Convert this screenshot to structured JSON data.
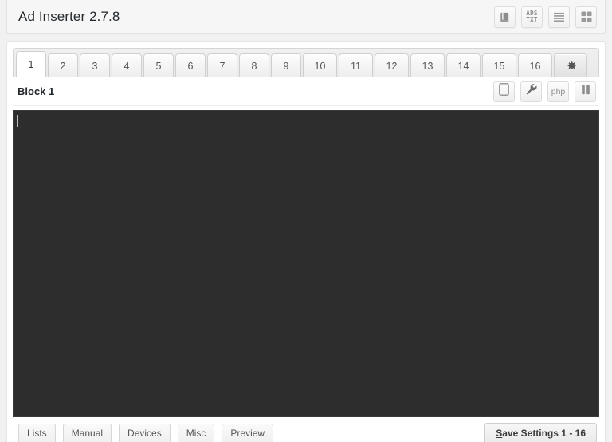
{
  "header": {
    "title": "Ad Inserter 2.7.8",
    "icons": [
      {
        "name": "book-icon",
        "label": "Documentation"
      },
      {
        "name": "ads-txt-icon",
        "label": "ADS TXT",
        "line1": "ADS",
        "line2": "TXT"
      },
      {
        "name": "list-icon",
        "label": "List view"
      },
      {
        "name": "grid-icon",
        "label": "Grid view"
      }
    ]
  },
  "tabs": {
    "items": [
      {
        "label": "1",
        "active": true
      },
      {
        "label": "2",
        "active": false
      },
      {
        "label": "3",
        "active": false
      },
      {
        "label": "4",
        "active": false
      },
      {
        "label": "5",
        "active": false
      },
      {
        "label": "6",
        "active": false
      },
      {
        "label": "7",
        "active": false
      },
      {
        "label": "8",
        "active": false
      },
      {
        "label": "9",
        "active": false
      },
      {
        "label": "10",
        "active": false
      },
      {
        "label": "11",
        "active": false
      },
      {
        "label": "12",
        "active": false
      },
      {
        "label": "13",
        "active": false
      },
      {
        "label": "14",
        "active": false
      },
      {
        "label": "15",
        "active": false
      },
      {
        "label": "16",
        "active": false
      }
    ],
    "settings_tab": {
      "name": "gear-icon",
      "label": ""
    }
  },
  "block": {
    "name": "Block 1",
    "tools": [
      {
        "name": "device-icon",
        "label": ""
      },
      {
        "name": "wrench-icon",
        "label": ""
      },
      {
        "name": "php-button",
        "label": "php"
      },
      {
        "name": "pause-icon",
        "label": ""
      }
    ]
  },
  "editor": {
    "value": "",
    "placeholder": ""
  },
  "footer": {
    "buttons": [
      {
        "name": "lists-button",
        "label": "Lists"
      },
      {
        "name": "manual-button",
        "label": "Manual"
      },
      {
        "name": "devices-button",
        "label": "Devices"
      },
      {
        "name": "misc-button",
        "label": "Misc"
      },
      {
        "name": "preview-button",
        "label": "Preview"
      }
    ],
    "save": {
      "accesskey": "S",
      "label_rest": "ave Settings 1 - 16"
    }
  },
  "colors": {
    "page_bg": "#f1f1f1",
    "panel_bg": "#ffffff",
    "editor_bg": "#2d2d2d",
    "text": "#23282d",
    "muted": "#8d8d8d"
  }
}
